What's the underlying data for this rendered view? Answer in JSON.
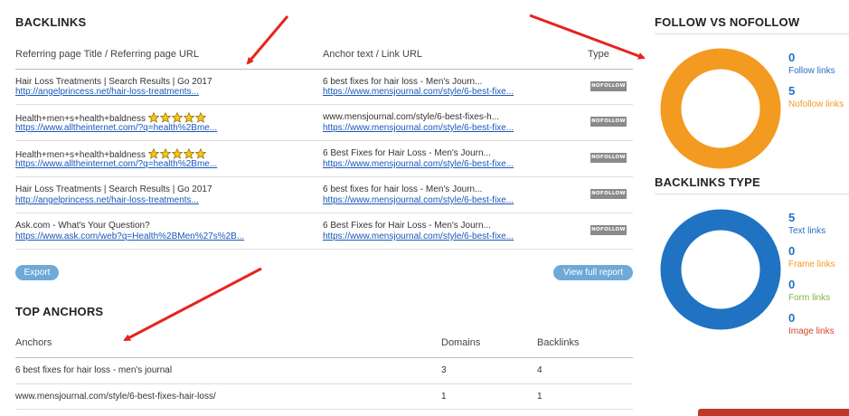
{
  "backlinks": {
    "title": "BACKLINKS",
    "columns": {
      "page": "Referring page Title / Referring page URL",
      "anchor": "Anchor text / Link URL",
      "type": "Type"
    },
    "rows": [
      {
        "title": "Hair Loss Treatments | Search Results | Go 2017",
        "url": "http://angelprincess.net/hair-loss-treatments...",
        "anchor": "6 best fixes for hair loss - Men's Journ...",
        "link": "https://www.mensjournal.com/style/6-best-fixe...",
        "type": "NOFOLLOW",
        "stars": false
      },
      {
        "title": "Health+men+s+health+baldness",
        "url": "https://www.alltheinternet.com/?q=health%2Bme...",
        "anchor": "www.mensjournal.com/style/6-best-fixes-h...",
        "link": "https://www.mensjournal.com/style/6-best-fixe...",
        "type": "NOFOLLOW",
        "stars": true
      },
      {
        "title": "Health+men+s+health+baldness",
        "url": "https://www.alltheinternet.com/?q=health%2Bme...",
        "anchor": "6 Best Fixes for Hair Loss - Men's Journ...",
        "link": "https://www.mensjournal.com/style/6-best-fixe...",
        "type": "NOFOLLOW",
        "stars": true
      },
      {
        "title": "Hair Loss Treatments | Search Results | Go 2017",
        "url": "http://angelprincess.net/hair-loss-treatments...",
        "anchor": "6 best fixes for hair loss - Men's Journ...",
        "link": "https://www.mensjournal.com/style/6-best-fixe...",
        "type": "NOFOLLOW",
        "stars": false
      },
      {
        "title": "Ask.com - What's Your Question?",
        "url": "https://www.ask.com/web?q=Health%2BMen%27s%2B...",
        "anchor": "6 Best Fixes for Hair Loss - Men's Journ...",
        "link": "https://www.mensjournal.com/style/6-best-fixe...",
        "type": "NOFOLLOW",
        "stars": false
      }
    ],
    "export_label": "Export",
    "view_report_label": "View full report"
  },
  "top_anchors": {
    "title": "TOP ANCHORS",
    "columns": {
      "anchors": "Anchors",
      "domains": "Domains",
      "backlinks": "Backlinks"
    },
    "rows": [
      {
        "anchor": "6 best fixes for hair loss - men's journal",
        "domains": "3",
        "backlinks": "4"
      },
      {
        "anchor": "www.mensjournal.com/style/6-best-fixes-hair-loss/",
        "domains": "1",
        "backlinks": "1"
      }
    ]
  },
  "follow_nofollow": {
    "title": "FOLLOW VS NOFOLLOW",
    "ring_color": "#f39a21",
    "stats": [
      {
        "value": "0",
        "label": "Follow links",
        "color": "#2370c3"
      },
      {
        "value": "5",
        "label": "Nofollow links",
        "color": "#f39a21"
      }
    ]
  },
  "backlinks_type": {
    "title": "BACKLINKS TYPE",
    "ring_color": "#1f73c2",
    "stats": [
      {
        "value": "5",
        "label": "Text links",
        "color": "#2370c3"
      },
      {
        "value": "0",
        "label": "Frame links",
        "color": "#f39a21"
      },
      {
        "value": "0",
        "label": "Form links",
        "color": "#7cb342"
      },
      {
        "value": "0",
        "label": "Image links",
        "color": "#d9432f"
      }
    ]
  },
  "colors": {
    "annotation_arrow": "#e8231f",
    "bottom_widget": "#c0392b"
  }
}
